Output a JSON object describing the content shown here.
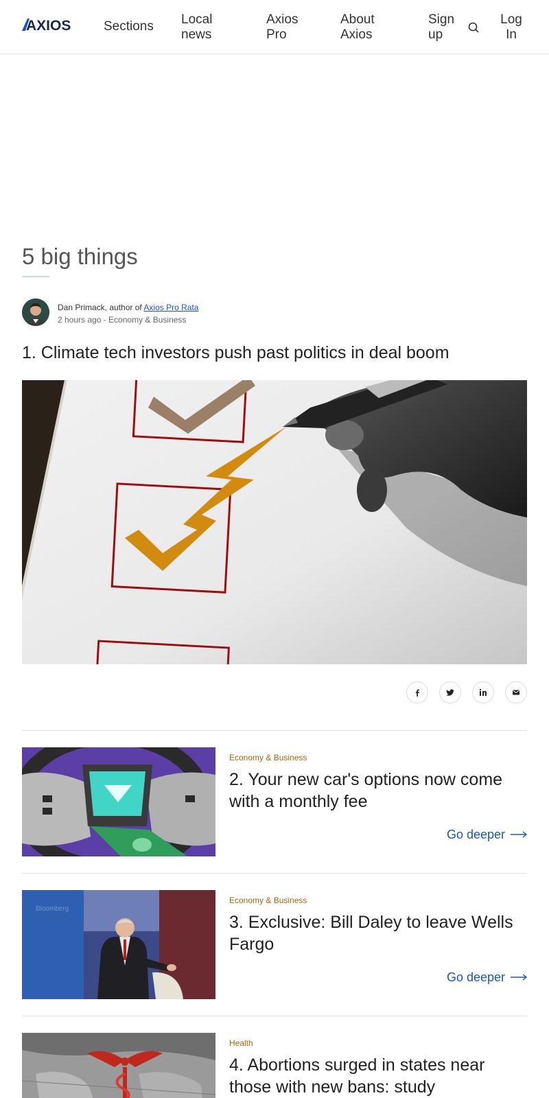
{
  "header": {
    "logo_text": "AXIOS",
    "nav": {
      "sections": "Sections",
      "local_news": "Local news",
      "axios_pro": "Axios Pro",
      "about_axios": "About Axios",
      "sign_up": "Sign up",
      "log_in": "Log In"
    },
    "search_icon": "search-icon"
  },
  "main": {
    "section_title": "5 big things",
    "byline": {
      "author_prefix": "Dan Primack, author of ",
      "author_link": "Axios Pro Rata",
      "meta": "2 hours ago - Economy & Business"
    },
    "story1": {
      "title": "1. Climate tech investors push past politics in deal boom"
    },
    "share": {
      "facebook_icon": "facebook-icon",
      "twitter_icon": "twitter-icon",
      "linkedin_icon": "linkedin-icon",
      "email_icon": "email-icon"
    },
    "stories": [
      {
        "category": "Economy & Business",
        "title": "2. Your new car's options now come with a monthly fee",
        "cta": "Go deeper"
      },
      {
        "category": "Economy & Business",
        "title": "3. Exclusive: Bill Daley to leave Wells Fargo",
        "cta": "Go deeper"
      },
      {
        "category": "Health",
        "title": "4. Abortions surged in states near those with new bans: study"
      }
    ]
  },
  "colors": {
    "link_blue": "#1a56c4",
    "category_gold": "#a0680c",
    "logo_navy": "#1b2a4a"
  }
}
